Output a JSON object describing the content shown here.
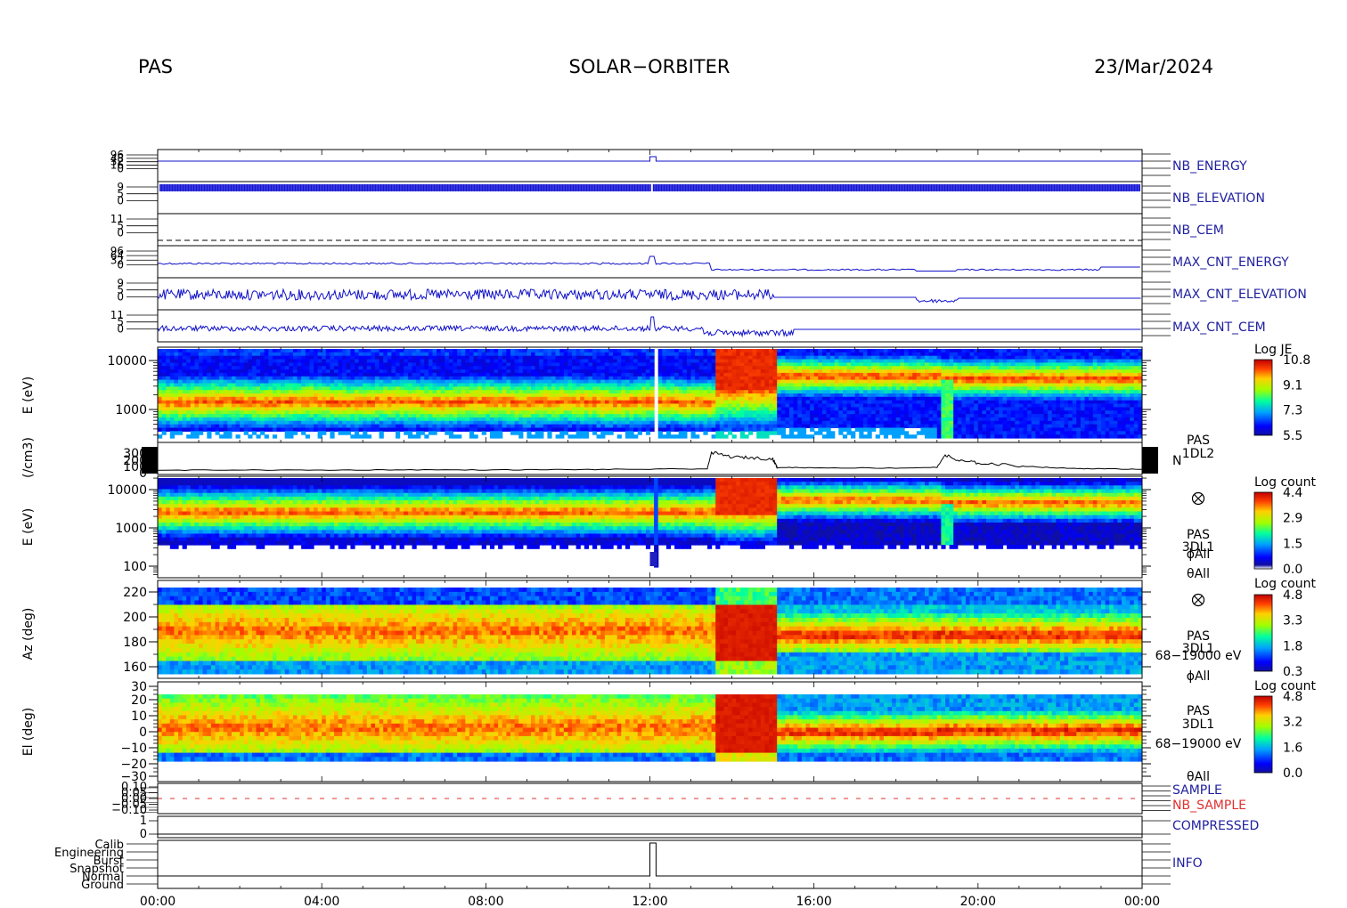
{
  "header": {
    "left": "PAS",
    "center": "SOLAR−ORBITER",
    "right": "23/Mar/2024"
  },
  "colors": {
    "line_blue": "#1010c8",
    "label_blue": "#2020a0",
    "sample_red": "#e03030",
    "frame": "#000000",
    "colormap": [
      "#000090",
      "#0000ff",
      "#0080ff",
      "#00e0ff",
      "#20ff80",
      "#c0ff00",
      "#ffe000",
      "#ff8000",
      "#e00000",
      "#900000"
    ]
  },
  "chart_data": [
    {
      "type": "line",
      "name": "housekeeping_panels",
      "x_ticks": [
        "00:00",
        "04:00",
        "08:00",
        "12:00",
        "16:00",
        "20:00",
        "00:00"
      ],
      "x_range_hours": [
        0,
        24
      ],
      "panels": [
        {
          "label": "NB_ENERGY",
          "label_color": "#2020a0",
          "y_ticks": [
            "96",
            "48",
            "32",
            "16",
            "0"
          ],
          "note": "flat near 0, small step at 12:00"
        },
        {
          "label": "NB_ELEVATION",
          "label_color": "#2020a0",
          "y_ticks": [
            "9",
            "5",
            "0"
          ],
          "note": "dense oscillation 0-9 throughout"
        },
        {
          "label": "NB_CEM",
          "label_color": "#2020a0",
          "y_ticks": [
            "11",
            "5",
            "0"
          ],
          "note": "dashed constant line"
        },
        {
          "label": "MAX_CNT_ENERGY",
          "label_color": "#2020a0",
          "y_ticks": [
            "96",
            "64",
            "32",
            "0"
          ],
          "note": "higher before 13:30, drops after"
        },
        {
          "label": "MAX_CNT_ELEVATION",
          "label_color": "#2020a0",
          "y_ticks": [
            "9",
            "5",
            "0"
          ],
          "note": "noisy until 15:00, then flat"
        },
        {
          "label": "MAX_CNT_CEM",
          "label_color": "#2020a0",
          "y_ticks": [
            "11",
            "5",
            "0"
          ],
          "note": "noisy, dip near 14:00"
        }
      ]
    },
    {
      "type": "heatmap",
      "name": "energy_spectrogram_1DL2",
      "ylabel": "E (eV)",
      "y_ticks": [
        "10000",
        "1000"
      ],
      "y_scale": "log",
      "colorbar": {
        "title": "Log JE",
        "ticks": [
          "10.8",
          "9.1",
          "7.3",
          "5.5"
        ]
      },
      "side_label": [
        "PAS",
        "1DL2"
      ],
      "description_values": {
        "peak_energy_before_13h_eV": 1200,
        "peak_energy_after_13h_eV": 5000,
        "gap_hours": [
          12.0,
          12.1
        ],
        "burst_hours": [
          13.5,
          15.0
        ]
      }
    },
    {
      "type": "line",
      "name": "density",
      "ylabel": "(/cm3)",
      "y_ticks": [
        "300",
        "200",
        "100",
        "0"
      ],
      "side_label": "N",
      "x": [
        0,
        2,
        4,
        6,
        8,
        10,
        12,
        13.4,
        13.5,
        14,
        14.5,
        15,
        15.1,
        16,
        18,
        19,
        19.2,
        19.5,
        20,
        21,
        22,
        23,
        24
      ],
      "y": [
        20,
        25,
        22,
        28,
        25,
        30,
        35,
        40,
        260,
        200,
        190,
        170,
        60,
        55,
        50,
        60,
        230,
        150,
        120,
        80,
        50,
        40,
        35
      ]
    },
    {
      "type": "heatmap",
      "name": "energy_spectrogram_3DL1",
      "ylabel": "E (eV)",
      "y_ticks": [
        "10000",
        "1000",
        "100"
      ],
      "y_scale": "log",
      "colorbar": {
        "title": "Log count",
        "ticks": [
          "4.4",
          "2.9",
          "1.5",
          "0.0"
        ]
      },
      "side_label": [
        "PAS",
        "3DL1",
        "ϕAll",
        "θAll"
      ]
    },
    {
      "type": "heatmap",
      "name": "azimuth_spectrogram",
      "ylabel": "Az (deg)",
      "y_ticks": [
        "220",
        "200",
        "180",
        "160"
      ],
      "y_range": [
        152,
        224
      ],
      "colorbar": {
        "title": "Log count",
        "ticks": [
          "4.8",
          "3.3",
          "1.8",
          "0.3"
        ]
      },
      "side_label": [
        "PAS",
        "3DL1",
        "68−19000 eV",
        "ϕAll"
      ]
    },
    {
      "type": "heatmap",
      "name": "elevation_spectrogram",
      "ylabel": "El (deg)",
      "y_ticks": [
        "30",
        "20",
        "10",
        "0",
        "−10",
        "−20",
        "−30"
      ],
      "y_range": [
        -30,
        30
      ],
      "colorbar": {
        "title": "Log count",
        "ticks": [
          "4.8",
          "3.2",
          "1.6",
          "0.0"
        ]
      },
      "side_label": [
        "PAS",
        "3DL1",
        "68−19000 eV",
        "θAll"
      ]
    },
    {
      "type": "line",
      "name": "status_panels",
      "panels": [
        {
          "labels": [
            "SAMPLE",
            "NB_SAMPLE"
          ],
          "label_colors": [
            "#2020a0",
            "#e03030"
          ],
          "y_ticks": [
            "0.10",
            "0.05",
            "0.00",
            "−0.05",
            "−0.10"
          ]
        },
        {
          "labels": [
            "COMPRESSED"
          ],
          "label_colors": [
            "#2020a0"
          ],
          "y_ticks": [
            "1",
            "0"
          ]
        },
        {
          "labels": [
            "INFO"
          ],
          "label_colors": [
            "#2020a0"
          ],
          "y_ticks": [
            "Calib",
            "Engineering",
            "Burst",
            "Snapshot",
            "Normal",
            "Ground"
          ],
          "note": "Normal until 12:00, brief Calib at 12:00-12:10"
        }
      ]
    }
  ]
}
